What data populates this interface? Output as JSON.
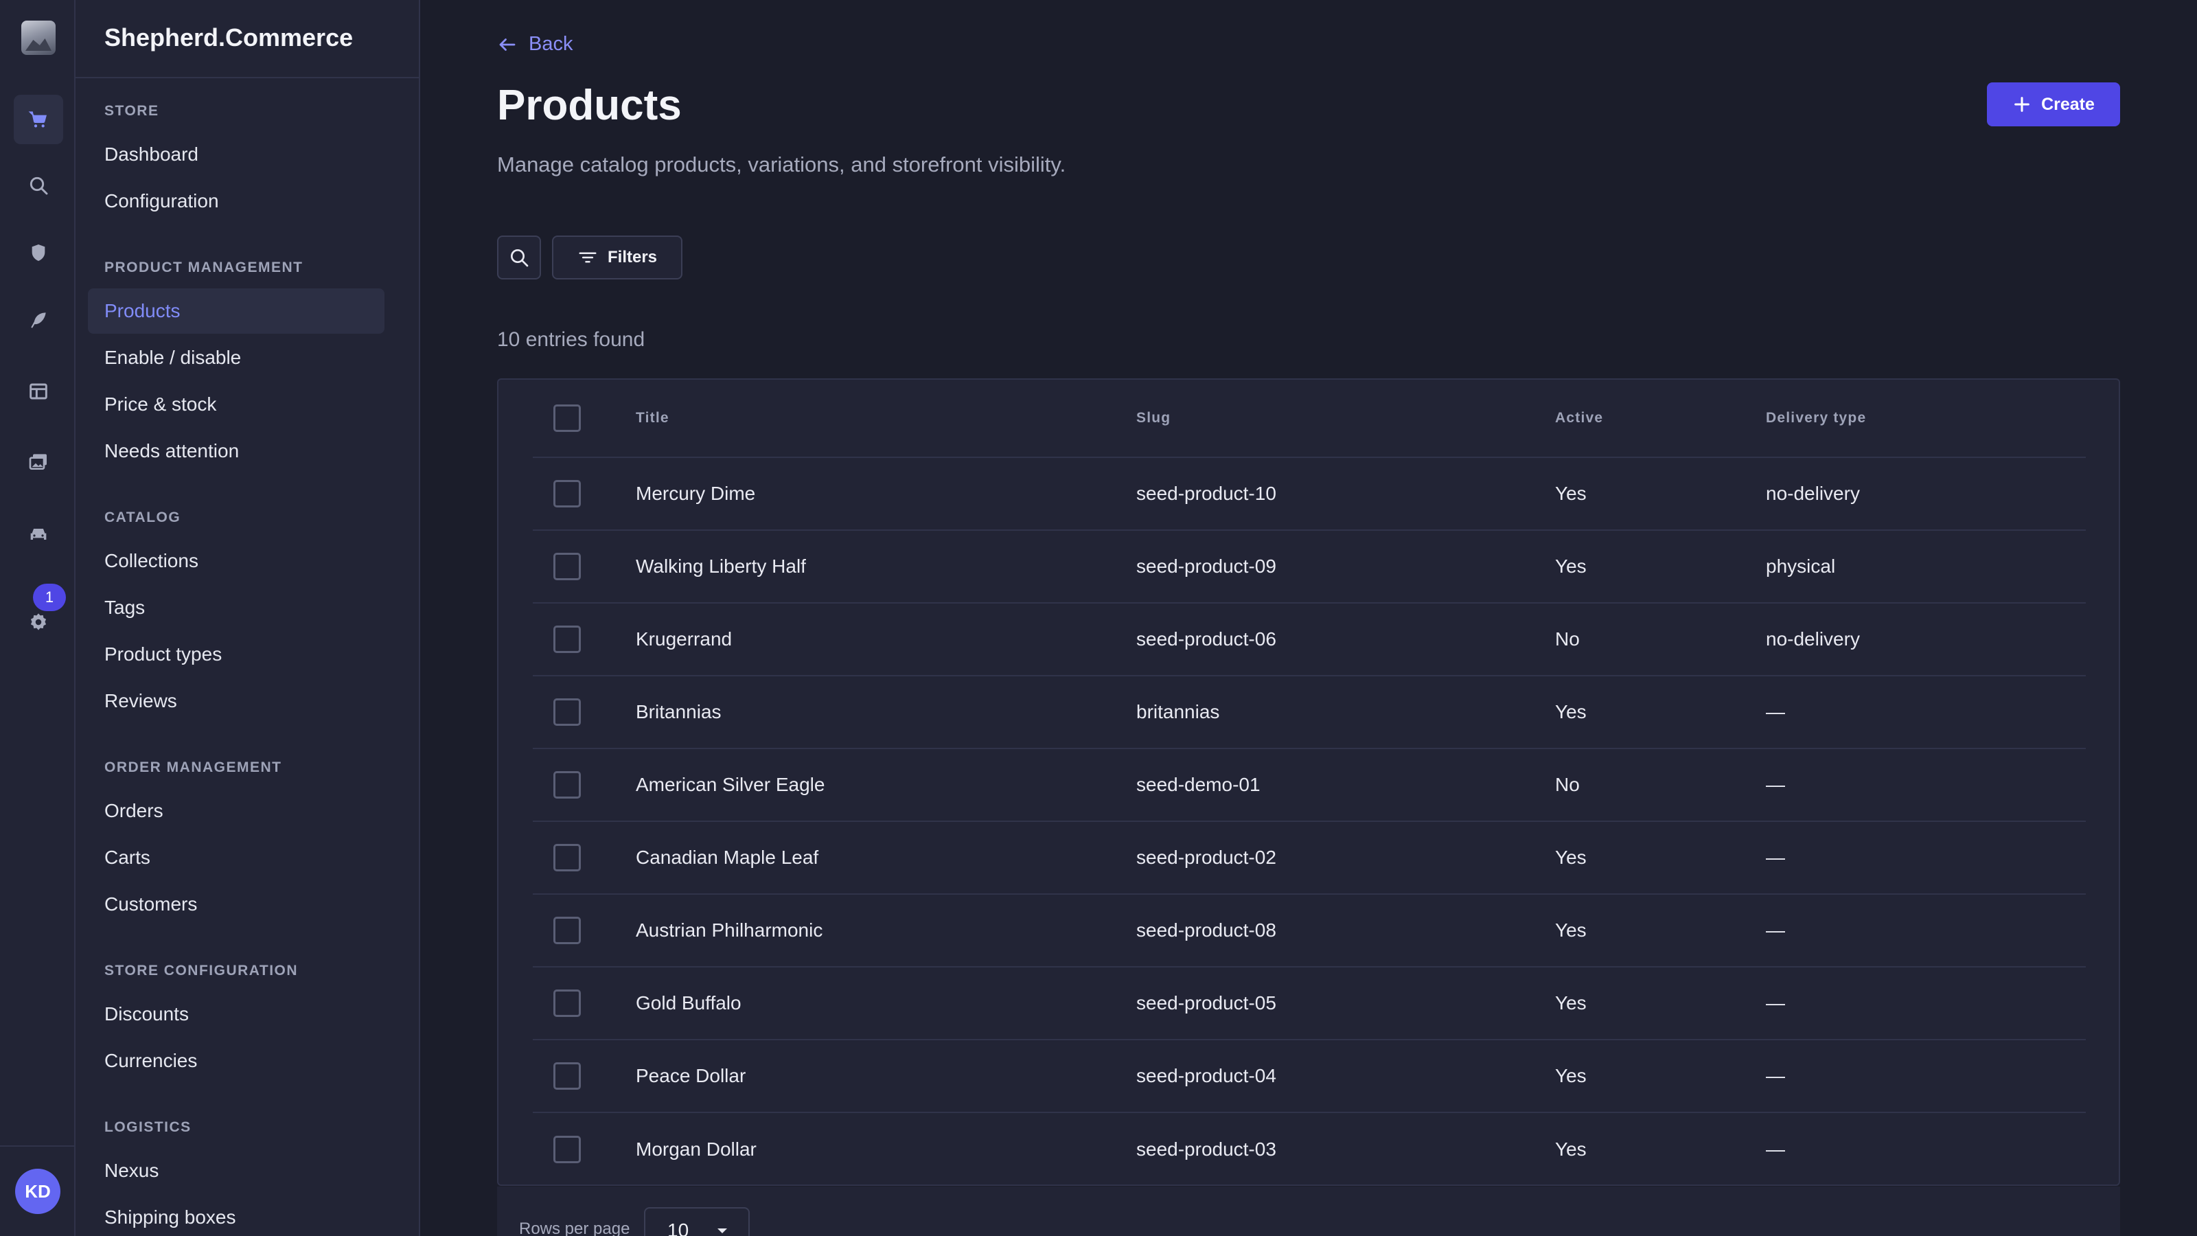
{
  "app": {
    "brand": "Shepherd.Commerce"
  },
  "rail": {
    "icons": [
      "cart-icon",
      "search-icon",
      "shield-icon",
      "feather-icon",
      "layout-icon",
      "images-icon",
      "car-icon",
      "settings-icon"
    ],
    "settings_badge": "1",
    "user_initials": "KD"
  },
  "nav": {
    "sections": [
      {
        "title": "Store",
        "items": [
          "Dashboard",
          "Configuration"
        ]
      },
      {
        "title": "Product management",
        "items": [
          "Products",
          "Enable / disable",
          "Price & stock",
          "Needs attention"
        ]
      },
      {
        "title": "Catalog",
        "items": [
          "Collections",
          "Tags",
          "Product types",
          "Reviews"
        ]
      },
      {
        "title": "Order management",
        "items": [
          "Orders",
          "Carts",
          "Customers"
        ]
      },
      {
        "title": "Store configuration",
        "items": [
          "Discounts",
          "Currencies"
        ]
      },
      {
        "title": "Logistics",
        "items": [
          "Nexus",
          "Shipping boxes"
        ]
      }
    ],
    "active_item": "Products"
  },
  "main": {
    "back_label": "Back",
    "title": "Products",
    "subtitle": "Manage catalog products, variations, and storefront visibility.",
    "create_label": "Create",
    "filters_label": "Filters",
    "entries_text": "10 entries found"
  },
  "table": {
    "columns": [
      "Title",
      "Slug",
      "Active",
      "Delivery type"
    ],
    "rows": [
      {
        "title": "Mercury Dime",
        "slug": "seed-product-10",
        "active": "Yes",
        "delivery": "no-delivery"
      },
      {
        "title": "Walking Liberty Half",
        "slug": "seed-product-09",
        "active": "Yes",
        "delivery": "physical"
      },
      {
        "title": "Krugerrand",
        "slug": "seed-product-06",
        "active": "No",
        "delivery": "no-delivery"
      },
      {
        "title": "Britannias",
        "slug": "britannias",
        "active": "Yes",
        "delivery": "—"
      },
      {
        "title": "American Silver Eagle",
        "slug": "seed-demo-01",
        "active": "No",
        "delivery": "—"
      },
      {
        "title": "Canadian Maple Leaf",
        "slug": "seed-product-02",
        "active": "Yes",
        "delivery": "—"
      },
      {
        "title": "Austrian Philharmonic",
        "slug": "seed-product-08",
        "active": "Yes",
        "delivery": "—"
      },
      {
        "title": "Gold Buffalo",
        "slug": "seed-product-05",
        "active": "Yes",
        "delivery": "—"
      },
      {
        "title": "Peace Dollar",
        "slug": "seed-product-04",
        "active": "Yes",
        "delivery": "—"
      },
      {
        "title": "Morgan Dollar",
        "slug": "seed-product-03",
        "active": "Yes",
        "delivery": "—"
      }
    ]
  },
  "pager": {
    "rows_per_page_label": "Rows per page",
    "rows_per_page_value": "10"
  },
  "colors": {
    "accent": "#4f46e5",
    "accent_text": "#818cf8",
    "background": "#1b1d2a",
    "panel": "#222435"
  }
}
